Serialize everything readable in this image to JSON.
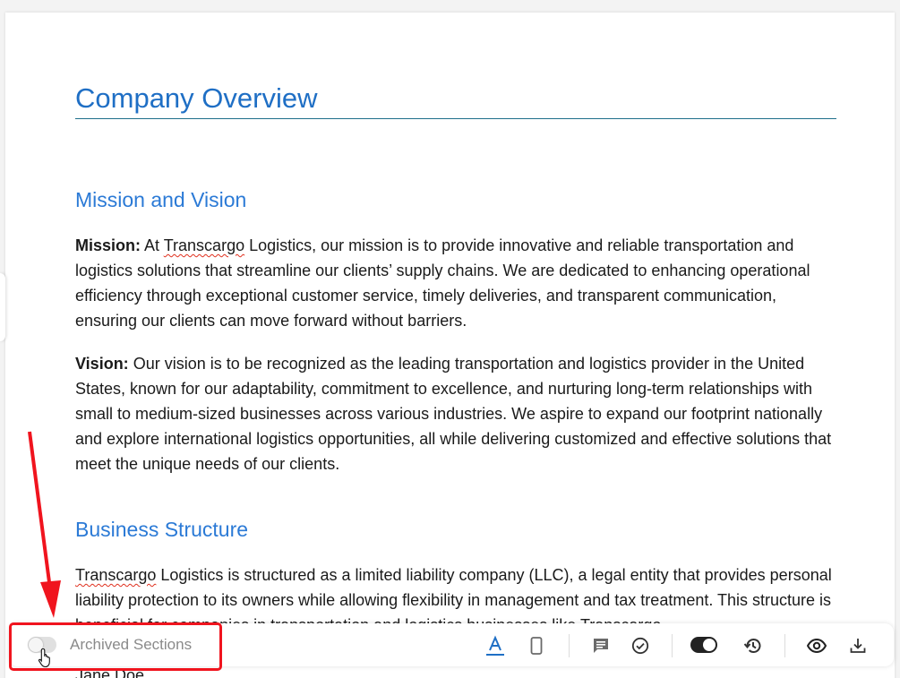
{
  "document": {
    "title": "Company Overview",
    "sections": [
      {
        "heading": "Mission and Vision",
        "paragraphs": [
          {
            "label": "Mission:",
            "pre": " At ",
            "spell": "Transcargo",
            "text": " Logistics, our mission is to provide innovative and reliable transportation and logistics solutions that streamline our clients’ supply chains. We are dedicated to enhancing operational efficiency through exceptional customer service, timely deliveries, and transparent communication, ensuring our clients can move forward without barriers."
          },
          {
            "label": "Vision:",
            "text": " Our vision is to be recognized as the leading transportation and logistics provider in the United States, known for our adaptability, commitment to excellence, and nurturing long-term relationships with small to medium-sized businesses across various industries. We aspire to expand our footprint nationally and explore international logistics opportunities, all while delivering customized and effective solutions that meet the unique needs of our clients."
          }
        ]
      },
      {
        "heading": "Business Structure",
        "paragraphs": [
          {
            "spell": "Transcargo",
            "text": " Logistics is structured as a limited liability company (LLC), a legal entity that provides personal liability protection to its owners while allowing flexibility in management and tax treatment. This structure is beneficial for companies in transportation and logistics businesses like Transcargo"
          }
        ],
        "trailing_text": "Jane Doe"
      }
    ]
  },
  "toolbar": {
    "archived_toggle": {
      "label": "Archived Sections",
      "on": false
    },
    "view_toggle": {
      "on": true
    },
    "icons": [
      "text-format-icon",
      "mobile-device-icon",
      "comment-icon",
      "check-circle-icon",
      "history-icon",
      "preview-eye-icon",
      "download-icon"
    ],
    "accent_color": "#1f6fc5"
  },
  "annotation": {
    "color": "#f0141e"
  }
}
